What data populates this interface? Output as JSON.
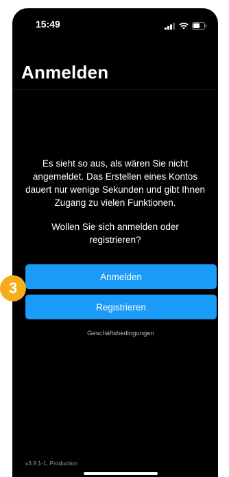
{
  "status_bar": {
    "time": "15:49",
    "icons": [
      "cellular-signal-icon",
      "wifi-icon",
      "battery-icon"
    ]
  },
  "header": {
    "title": "Anmelden"
  },
  "main": {
    "info_text": "Es sieht so aus, als wären Sie nicht angemeldet. Das Erstellen eines Kontos dauert nur wenige Sekunden und gibt Ihnen Zugang zu vielen Funktionen.",
    "question_text": "Wollen Sie sich anmelden oder registrieren?",
    "login_button_label": "Anmelden",
    "register_button_label": "Registrieren",
    "terms_link_label": "Geschäftsbedingungen"
  },
  "footer": {
    "version": "v3.9.1-1, Production"
  },
  "annotation": {
    "step_number": "3",
    "color": "#f6ac1d"
  },
  "colors": {
    "background": "#000000",
    "accent_button": "#1a9bf7",
    "text_primary": "#ffffff",
    "text_muted": "#b9b9b9"
  }
}
